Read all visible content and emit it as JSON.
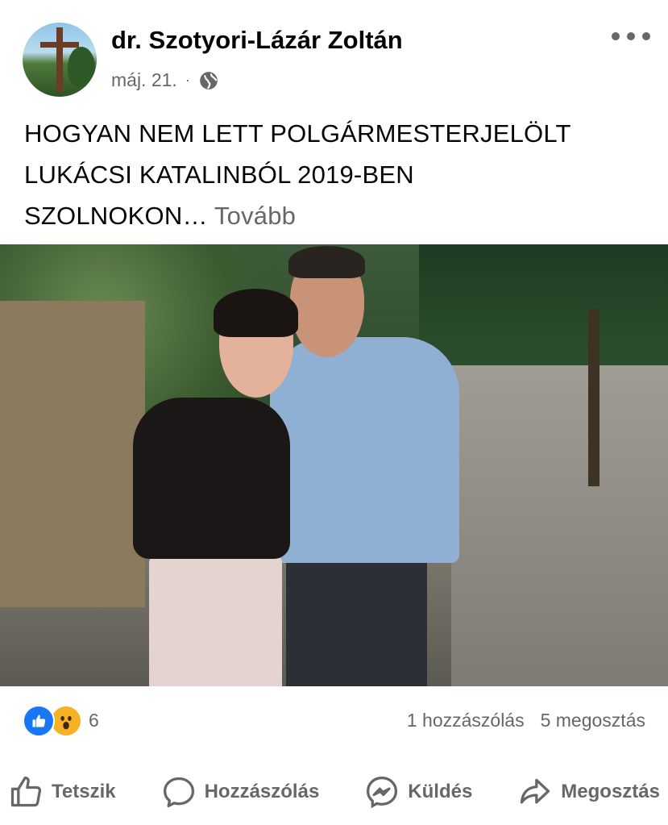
{
  "post": {
    "author": "dr. Szotyori-Lázár Zoltán",
    "date": "máj. 21.",
    "separator": "·",
    "audience_icon": "globe-icon",
    "menu_icon": "more-options-icon",
    "text_line1": "HOGYAN NEM LETT POLGÁRMESTERJELÖLT",
    "text_line2": "LUKÁCSI KATALINBÓL 2019-BEN",
    "text_line3": "SZOLNOKON…",
    "see_more": "Tovább"
  },
  "reactions": {
    "icons": [
      "like-reaction-icon",
      "wow-reaction-icon"
    ],
    "count": "6",
    "comments": "1 hozzászólás",
    "shares": "5 megosztás"
  },
  "actions": {
    "like": "Tetszik",
    "comment": "Hozzászólás",
    "send": "Küldés",
    "share": "Megosztás"
  },
  "colors": {
    "secondary_text": "#65676b",
    "like_blue": "#1877f2",
    "wow_yellow": "#f7b125"
  }
}
